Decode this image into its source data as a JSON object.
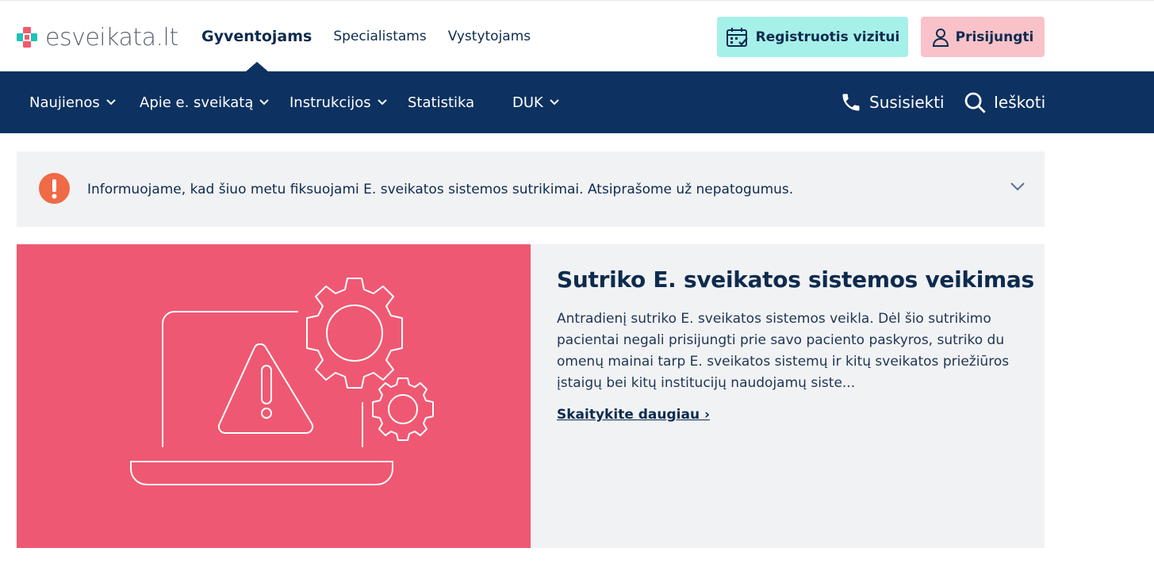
{
  "brand": {
    "logo_text": "esveikata.lt"
  },
  "audience_tabs": [
    {
      "label": "Gyventojams",
      "active": true
    },
    {
      "label": "Specialistams",
      "active": false
    },
    {
      "label": "Vystytojams",
      "active": false
    }
  ],
  "header_buttons": {
    "register": {
      "label": "Registruotis vizitui",
      "icon": "calendar-icon"
    },
    "login": {
      "label": "Prisijungti",
      "icon": "user-icon"
    }
  },
  "nav": {
    "items": [
      {
        "label": "Naujienos",
        "has_dropdown": true
      },
      {
        "label": "Apie e. sveikatą",
        "has_dropdown": true
      },
      {
        "label": "Instrukcijos",
        "has_dropdown": true
      },
      {
        "label": "Statistika",
        "has_dropdown": false
      },
      {
        "label": "DUK",
        "has_dropdown": true
      }
    ],
    "contact": {
      "label": "Susisiekti",
      "icon": "phone-icon"
    },
    "search": {
      "label": "Ieškoti",
      "icon": "search-icon"
    }
  },
  "alert": {
    "icon": "exclamation-icon",
    "text": "Informuojame, kad šiuo metu fiksuojami E. sveikatos sistemos sutrikimai. Atsiprašome už nepatogumus."
  },
  "hero": {
    "title": "Sutriko E. sveikatos sistemos veikimas",
    "description": "Antradienį sutriko E. sveikatos sistemos veikla. Dėl šio sutrikimo pacientai negali prisijungti prie savo paciento paskyros, sutriko du omenų mainai tarp E. sveikatos sistemų ir kitų sveikatos priežiūros įstaigų bei kitų institucijų naudojamų siste...",
    "link": "Skaitykite daugiau ›",
    "illustration": "laptop-warning-gears-illustration"
  },
  "colors": {
    "navy": "#0d3160",
    "text": "#0d2b4e",
    "register_bg": "#a6f0ea",
    "login_bg": "#f9c2c9",
    "hero_pink": "#ef5872",
    "alert_orange": "#ef6a45",
    "panel_gray": "#f1f2f4"
  }
}
